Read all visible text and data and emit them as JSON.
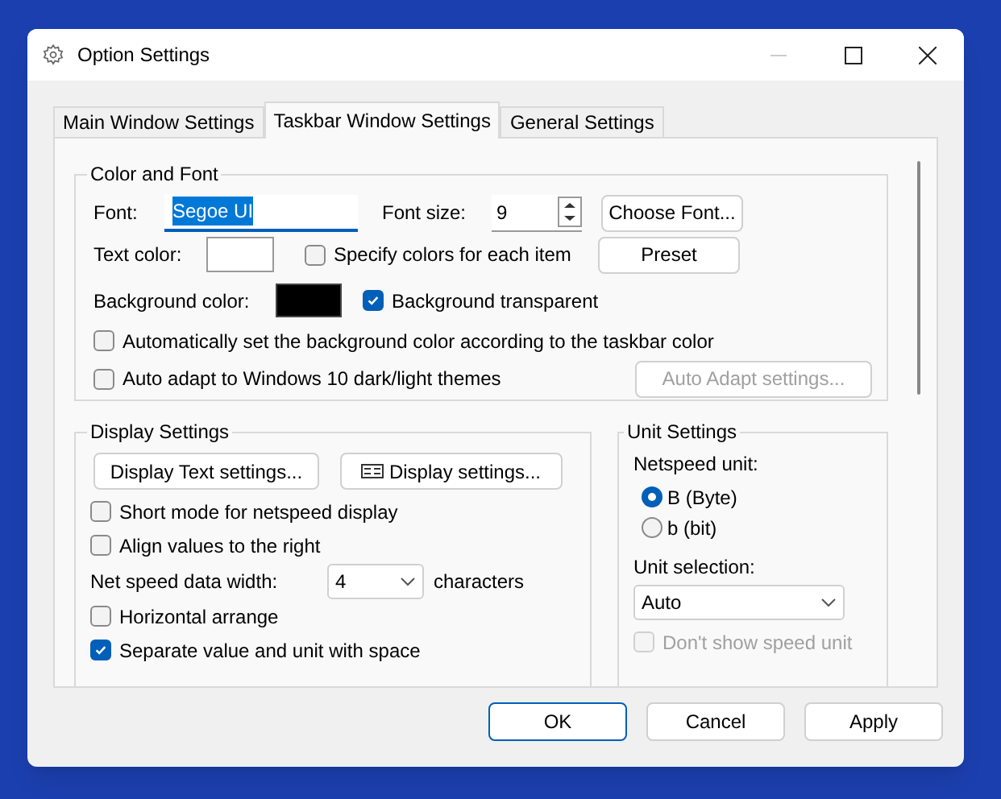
{
  "window": {
    "title": "Option Settings"
  },
  "tabs": [
    {
      "label": "Main Window Settings",
      "selected": false
    },
    {
      "label": "Taskbar Window Settings",
      "selected": true
    },
    {
      "label": "General Settings",
      "selected": false
    }
  ],
  "color_and_font": {
    "title": "Color and Font",
    "font_label": "Font:",
    "font_value": "Segoe UI",
    "font_size_label": "Font size:",
    "font_size_value": "9",
    "choose_font_button": "Choose Font...",
    "text_color_label": "Text color:",
    "text_color_swatch": {
      "color": "#ffffff"
    },
    "specify_colors": {
      "label": "Specify colors for each item",
      "checked": false
    },
    "preset_button": "Preset",
    "background_color_label": "Background color:",
    "background_color_swatch": {
      "color": "#000000"
    },
    "background_transparent": {
      "label": "Background transparent",
      "checked": true
    },
    "auto_background": {
      "label": "Automatically set the background color according to the taskbar color",
      "checked": false
    },
    "auto_adapt": {
      "label": "Auto adapt to Windows 10 dark/light themes",
      "checked": false
    },
    "auto_adapt_button": {
      "label": "Auto Adapt settings...",
      "disabled": true
    }
  },
  "display_settings": {
    "title": "Display Settings",
    "text_settings_button": "Display Text settings...",
    "display_settings_button": "Display settings...",
    "checks_top": [
      {
        "label": "Short mode for netspeed display",
        "checked": false
      },
      {
        "label": "Align values to the right",
        "checked": false
      }
    ],
    "width_label": "Net speed data width:",
    "width_value": "4",
    "width_unit": "characters",
    "checks_bottom": [
      {
        "label": "Horizontal arrange",
        "checked": false
      },
      {
        "label": "Separate value and unit with space",
        "checked": true
      }
    ]
  },
  "unit_settings": {
    "title": "Unit Settings",
    "netspeed_unit_label": "Netspeed unit:",
    "units": [
      {
        "label": "B (Byte)",
        "selected": true
      },
      {
        "label": "b (bit)",
        "selected": false
      }
    ],
    "unit_selection_label": "Unit selection:",
    "unit_selection_value": "Auto",
    "hide_unit": {
      "label": "Don't show speed unit",
      "checked": false,
      "disabled": true
    }
  },
  "buttons": [
    "OK",
    "Cancel",
    "Apply"
  ]
}
